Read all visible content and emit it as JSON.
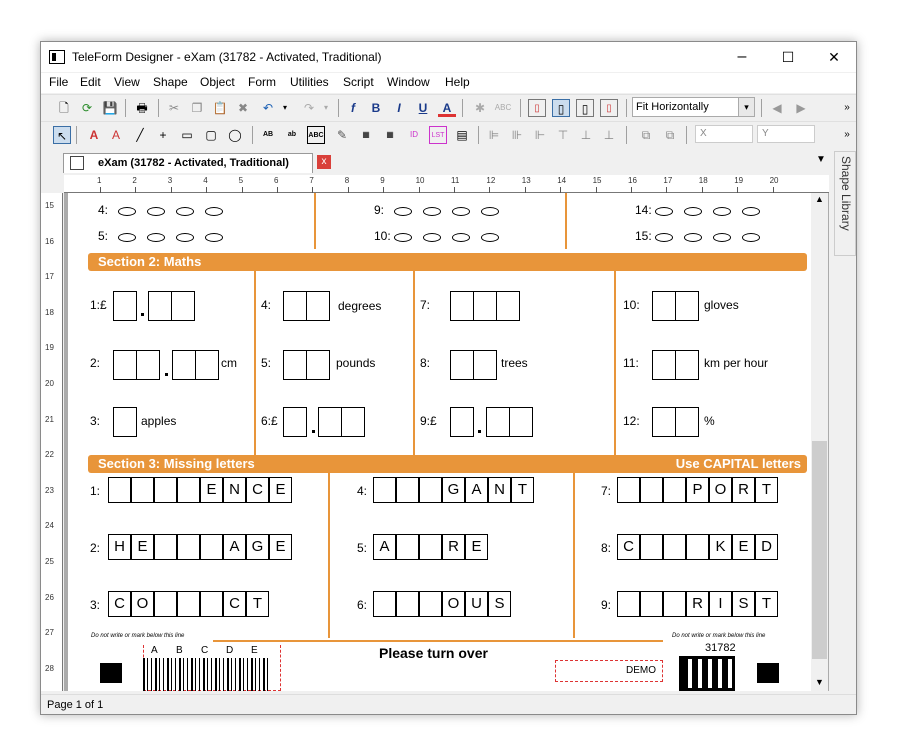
{
  "window": {
    "title": "TeleForm Designer - eXam (31782 - Activated, Traditional)",
    "minimize": "–",
    "maximize": "☐",
    "close": "✕"
  },
  "menu": [
    "File",
    "Edit",
    "View",
    "Shape",
    "Object",
    "Form",
    "Utilities",
    "Script",
    "Window",
    "Help"
  ],
  "toolbar": {
    "zoom": "Fit Horizontally",
    "zoom_arrow": "▾",
    "x_label": "X",
    "y_label": "Y",
    "more": "»"
  },
  "doc_tab": {
    "title": "eXam (31782 - Activated, Traditional)",
    "close": "x"
  },
  "shape_library": "Shape Library",
  "status": "Page 1 of 1",
  "ruler": {
    "h": [
      "1",
      "2",
      "3",
      "4",
      "5",
      "6",
      "7",
      "8",
      "9",
      "10",
      "11",
      "12",
      "13",
      "14",
      "15",
      "16",
      "17",
      "18",
      "19",
      "20"
    ],
    "v": [
      "15",
      "16",
      "17",
      "18",
      "19",
      "20",
      "21",
      "22",
      "23",
      "24",
      "25",
      "26",
      "27",
      "28"
    ]
  },
  "section1_rows": [
    {
      "a": "4:",
      "b": "9:",
      "c": "14:"
    },
    {
      "a": "5:",
      "b": "10:",
      "c": "15:"
    }
  ],
  "section2": {
    "title": "Section 2: Maths",
    "items": {
      "q1": "1:£",
      "q2": "2:",
      "q3": "3:",
      "q4": "4:",
      "q5": "5:",
      "q6": "6:£",
      "q7": "7:",
      "q8": "8:",
      "q9": "9:£",
      "q10": "10:",
      "q11": "11:",
      "q12": "12:"
    },
    "units": {
      "q2": "cm",
      "q3": "apples",
      "q4": "degrees",
      "q5": "pounds",
      "q8": "trees",
      "q10": "gloves",
      "q11": "km per hour",
      "q12": "%"
    }
  },
  "section3": {
    "title": "Section 3: Missing letters",
    "note": "Use CAPITAL letters",
    "items": [
      {
        "n": "1:",
        "letters": [
          "",
          "",
          "",
          "",
          "E",
          "N",
          "C",
          "E"
        ]
      },
      {
        "n": "2:",
        "letters": [
          "H",
          "E",
          "",
          "",
          "",
          "A",
          "G",
          "E"
        ]
      },
      {
        "n": "3:",
        "letters": [
          "C",
          "O",
          "",
          "",
          "",
          "C",
          "T"
        ]
      },
      {
        "n": "4:",
        "letters": [
          "",
          "",
          "",
          "G",
          "A",
          "N",
          "T"
        ]
      },
      {
        "n": "5:",
        "letters": [
          "A",
          "",
          "",
          "R",
          "E"
        ]
      },
      {
        "n": "6:",
        "letters": [
          "",
          "",
          "",
          "O",
          "U",
          "S"
        ]
      },
      {
        "n": "7:",
        "letters": [
          "",
          "",
          "",
          "P",
          "O",
          "R",
          "T"
        ]
      },
      {
        "n": "8:",
        "letters": [
          "C",
          "",
          "",
          "",
          "K",
          "E",
          "D"
        ]
      },
      {
        "n": "9:",
        "letters": [
          "",
          "",
          "",
          "R",
          "I",
          "S",
          "T"
        ]
      }
    ]
  },
  "footer": {
    "no_write_left": "Do not write or mark below this line",
    "no_write_right": "Do not write or mark below this line",
    "turn_over": "Please turn over",
    "form_id": "31782",
    "demo": "DEMO",
    "barcode_letters": [
      "A",
      "B",
      "C",
      "D",
      "E"
    ]
  }
}
